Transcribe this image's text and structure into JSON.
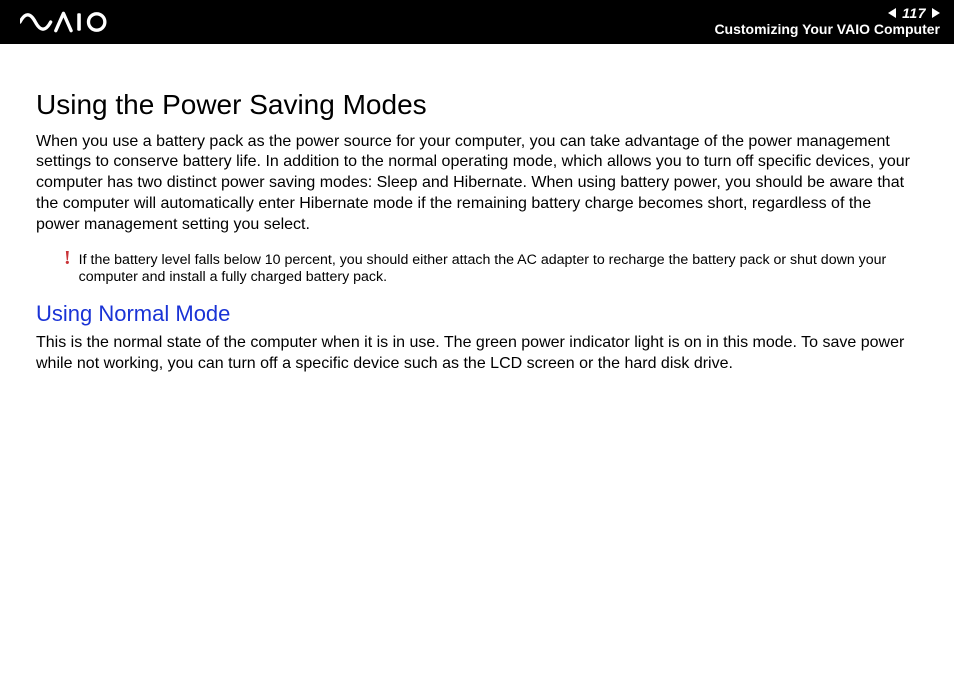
{
  "header": {
    "page_number": "117",
    "section_title": "Customizing Your VAIO Computer"
  },
  "content": {
    "heading": "Using the Power Saving Modes",
    "intro_paragraph": "When you use a battery pack as the power source for your computer, you can take advantage of the power management settings to conserve battery life. In addition to the normal operating mode, which allows you to turn off specific devices, your computer has two distinct power saving modes: Sleep and Hibernate. When using battery power, you should be aware that the computer will automatically enter Hibernate mode if the remaining battery charge becomes short, regardless of the power management setting you select.",
    "warning_icon": "!",
    "warning_text": "If the battery level falls below 10 percent, you should either attach the AC adapter to recharge the battery pack or shut down your computer and install a fully charged battery pack.",
    "subheading": "Using Normal Mode",
    "normal_mode_paragraph": "This is the normal state of the computer when it is in use. The green power indicator light is on in this mode. To save power while not working, you can turn off a specific device such as the LCD screen or the hard disk drive."
  }
}
